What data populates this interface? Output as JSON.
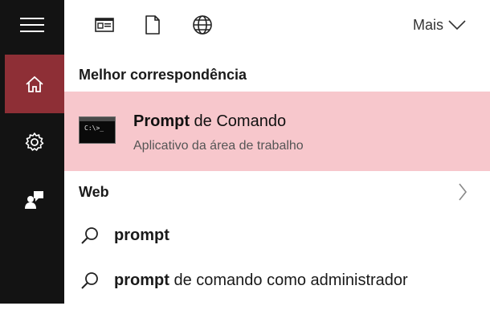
{
  "topbar": {
    "icons": [
      "document-view-icon",
      "page-icon",
      "globe-icon"
    ],
    "more_label": "Mais"
  },
  "best_match": {
    "section_title": "Melhor correspondência",
    "item": {
      "name_bold": "Prompt",
      "name_rest": " de Comando",
      "subtitle": "Aplicativo da área de trabalho",
      "icon_text": "C:\\>_"
    }
  },
  "web": {
    "section_title": "Web"
  },
  "results": [
    {
      "bold": "prompt",
      "rest": ""
    },
    {
      "bold": "prompt",
      "rest": " de comando como administrador"
    }
  ],
  "colors": {
    "rail_bg": "#131313",
    "rail_active": "#8e2f36",
    "selected_bg": "#f7c7cc"
  }
}
